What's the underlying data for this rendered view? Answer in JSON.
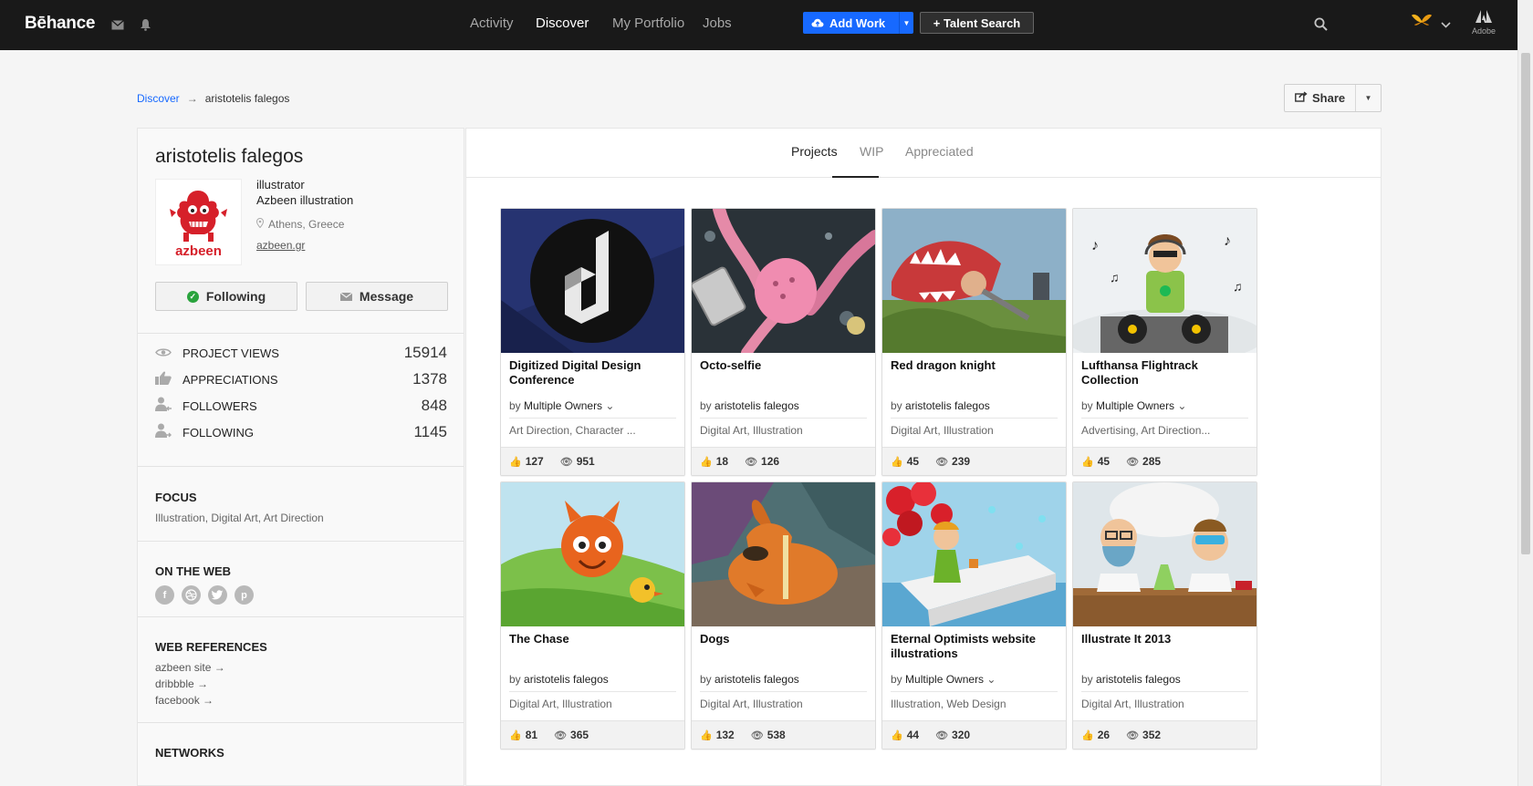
{
  "topbar": {
    "logo": "Bēhance",
    "nav": [
      "Activity",
      "Discover",
      "My Portfolio",
      "Jobs"
    ],
    "add_work": "Add Work",
    "talent_search": "+ Talent Search",
    "adobe_label": "Adobe"
  },
  "breadcrumb": {
    "link": "Discover",
    "arrow": "→",
    "current": "aristotelis falegos"
  },
  "share_label": "Share",
  "profile": {
    "name": "aristotelis falegos",
    "role": "illustrator",
    "company": "Azbeen illustration",
    "location": "Athens, Greece",
    "website": "azbeen.gr",
    "logo_text": "azbeen",
    "following_label": "Following",
    "message_label": "Message"
  },
  "stats": [
    {
      "label": "PROJECT VIEWS",
      "value": "15914"
    },
    {
      "label": "APPRECIATIONS",
      "value": "1378"
    },
    {
      "label": "FOLLOWERS",
      "value": "848"
    },
    {
      "label": "FOLLOWING",
      "value": "1145"
    }
  ],
  "focus": {
    "title": "FOCUS",
    "text": "Illustration, Digital Art, Art Direction"
  },
  "on_the_web": {
    "title": "ON THE WEB"
  },
  "web_references": {
    "title": "WEB REFERENCES",
    "links": [
      "azbeen site →",
      "dribbble →",
      "facebook →"
    ]
  },
  "networks": {
    "title": "NETWORKS"
  },
  "tabs": [
    "Projects",
    "WIP",
    "Appreciated"
  ],
  "projects": [
    {
      "title": "Digitized Digital Design Conference",
      "by": "by",
      "owner": "Multiple Owners",
      "multi": true,
      "fields": "Art Direction, Character ...",
      "likes": "127",
      "views": "951"
    },
    {
      "title": "Octo-selfie",
      "by": "by",
      "owner": "aristotelis falegos",
      "multi": false,
      "fields": "Digital Art, Illustration",
      "likes": "18",
      "views": "126"
    },
    {
      "title": "Red dragon knight",
      "by": "by",
      "owner": "aristotelis falegos",
      "multi": false,
      "fields": "Digital Art, Illustration",
      "likes": "45",
      "views": "239"
    },
    {
      "title": "Lufthansa Flightrack Collection",
      "by": "by",
      "owner": "Multiple Owners",
      "multi": true,
      "fields": "Advertising, Art Direction...",
      "likes": "45",
      "views": "285"
    },
    {
      "title": "The Chase",
      "by": "by",
      "owner": "aristotelis falegos",
      "multi": false,
      "fields": "Digital Art, Illustration",
      "likes": "81",
      "views": "365"
    },
    {
      "title": "Dogs",
      "by": "by",
      "owner": "aristotelis falegos",
      "multi": false,
      "fields": "Digital Art, Illustration",
      "likes": "132",
      "views": "538"
    },
    {
      "title": "Eternal Optimists website illustrations",
      "by": "by",
      "owner": "Multiple Owners",
      "multi": true,
      "fields": "Illustration, Web Design",
      "likes": "44",
      "views": "320"
    },
    {
      "title": "Illustrate It 2013",
      "by": "by",
      "owner": "aristotelis falegos",
      "multi": false,
      "fields": "Digital Art, Illustration",
      "likes": "26",
      "views": "352"
    }
  ],
  "colors": {
    "brand_blue": "#1769ff",
    "topbar": "#191919",
    "accent_red": "#d6202a",
    "following_green": "#2aa33d"
  }
}
